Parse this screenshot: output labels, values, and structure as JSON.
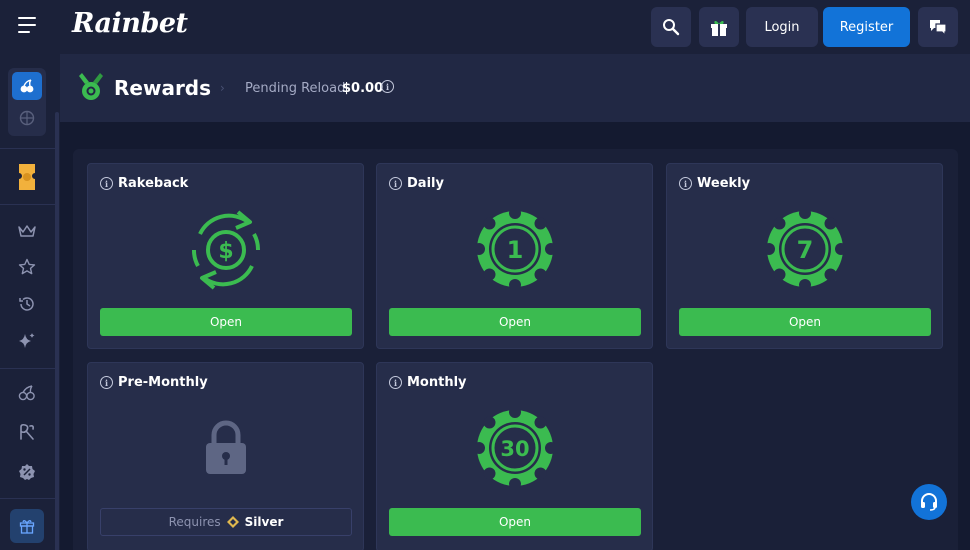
{
  "topbar": {
    "logo": "Rainbet",
    "login_label": "Login",
    "register_label": "Register",
    "icons": [
      "search-icon",
      "gift-icon",
      "chat-icon"
    ]
  },
  "sidebar": {
    "items": [
      "casino-icon",
      "sports-icon",
      "ticket-icon",
      "crown-icon",
      "star-icon",
      "history-icon",
      "sparkle-icon",
      "cherry-icon",
      "rainbet-icon",
      "badge-icon",
      "gift-icon"
    ]
  },
  "header": {
    "title": "Rewards",
    "pending_label": "Pending Reload",
    "pending_value": "$0.00"
  },
  "rewards": [
    {
      "title": "Rakeback",
      "button": "Open"
    },
    {
      "title": "Daily",
      "button": "Open",
      "chip_value": "1"
    },
    {
      "title": "Weekly",
      "button": "Open",
      "chip_value": "7"
    },
    {
      "title": "Pre-Monthly",
      "requires_label": "Requires",
      "requires_tier": "Silver"
    },
    {
      "title": "Monthly",
      "button": "Open",
      "chip_value": "30"
    }
  ],
  "colors": {
    "accent_green": "#3bbb50",
    "accent_blue": "#1273d8",
    "bg": "#141a30",
    "card": "#262d4a"
  }
}
